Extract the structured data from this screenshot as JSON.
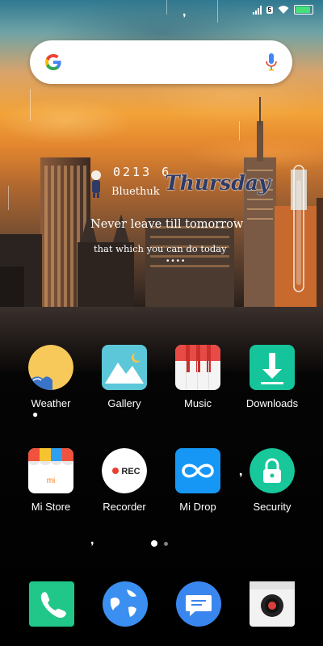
{
  "status_bar": {
    "lte_badge": "5",
    "battery_level": 0.9,
    "icons": [
      "signal-icon",
      "lte-icon",
      "wifi-icon",
      "battery-icon"
    ]
  },
  "search_bar": {
    "icons": [
      "google-g-icon",
      "mic-icon"
    ]
  },
  "widget": {
    "time": "0213 6",
    "name": "Bluethuk",
    "day": "Thursday",
    "quote_line1": "Never leave till tomorrow",
    "quote_line2": "that which you can do today",
    "dots": "• • • •"
  },
  "apps": [
    {
      "label": "Weather",
      "icon": "weather-icon"
    },
    {
      "label": "Gallery",
      "icon": "gallery-icon"
    },
    {
      "label": "Music",
      "icon": "music-icon"
    },
    {
      "label": "Downloads",
      "icon": "downloads-icon"
    },
    {
      "label": "Mi Store",
      "icon": "mi-store-icon"
    },
    {
      "label": "Recorder",
      "icon": "recorder-icon"
    },
    {
      "label": "Mi Drop",
      "icon": "mi-drop-icon"
    },
    {
      "label": "Security",
      "icon": "security-icon"
    }
  ],
  "icon_text": {
    "mi_store": "mi",
    "recorder": "REC"
  },
  "page_indicator": {
    "pages": 2,
    "current": 1
  },
  "dock": [
    {
      "icon": "phone-icon"
    },
    {
      "icon": "browser-globe-icon"
    },
    {
      "icon": "messages-icon"
    },
    {
      "icon": "camera-icon"
    }
  ],
  "colors": {
    "weather_bg": "#f7c95a",
    "gallery_bg": "#5bc7d8",
    "music_bg": "#f4f4f4",
    "downloads_bg": "#15c49a",
    "mi_store_bg": "#ffffff",
    "recorder_bg": "#ffffff",
    "mi_drop_bg": "#1697f5",
    "security_bg": "#18c79a",
    "phone_bg": "#21c788",
    "browser_bg": "#3b8ff0",
    "messages_bg": "#3a86ef",
    "camera_bg": "#f2f2f2"
  }
}
